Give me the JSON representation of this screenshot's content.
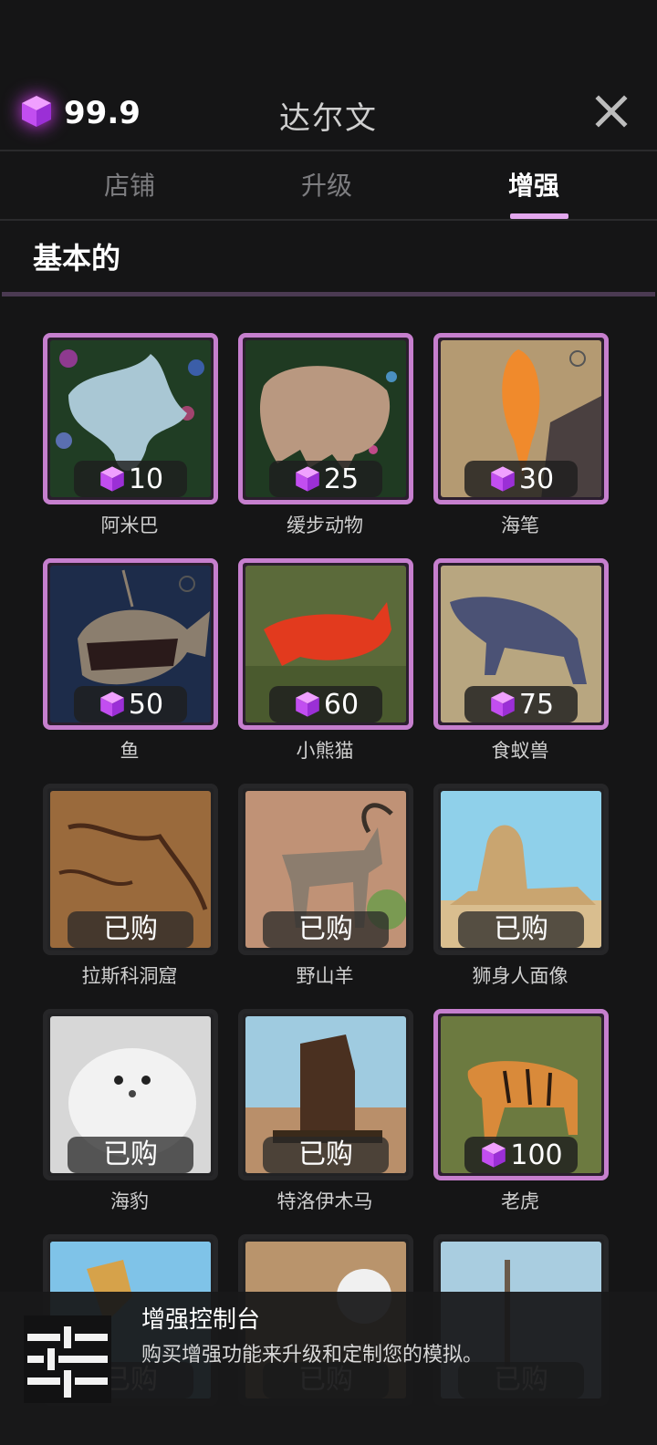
{
  "header": {
    "currency": "99.9",
    "title": "达尔文"
  },
  "tabs": [
    {
      "label": "店铺"
    },
    {
      "label": "升级"
    },
    {
      "label": "增强"
    }
  ],
  "section": {
    "title": "基本的"
  },
  "items": [
    {
      "name": "阿米巴",
      "price": "10",
      "status": "locked"
    },
    {
      "name": "缓步动物",
      "price": "25",
      "status": "locked"
    },
    {
      "name": "海笔",
      "price": "30",
      "status": "locked"
    },
    {
      "name": "鱼",
      "price": "50",
      "status": "locked"
    },
    {
      "name": "小熊猫",
      "price": "60",
      "status": "locked"
    },
    {
      "name": "食蚁兽",
      "price": "75",
      "status": "locked"
    },
    {
      "name": "拉斯科洞窟",
      "badge": "已购",
      "status": "owned"
    },
    {
      "name": "野山羊",
      "badge": "已购",
      "status": "owned"
    },
    {
      "name": "狮身人面像",
      "badge": "已购",
      "status": "owned"
    },
    {
      "name": "海豹",
      "badge": "已购",
      "status": "owned"
    },
    {
      "name": "特洛伊木马",
      "badge": "已购",
      "status": "owned"
    },
    {
      "name": "老虎",
      "price": "100",
      "status": "locked"
    },
    {
      "badge": "已购",
      "status": "owned"
    },
    {
      "badge": "已购",
      "status": "owned"
    },
    {
      "badge": "已购",
      "status": "owned"
    }
  ],
  "toast": {
    "title": "增强控制台",
    "description": "购买增强功能来升级和定制您的模拟。"
  },
  "colors": {
    "accent": "#c67fce",
    "gem": "#c64bf0",
    "background": "#151516"
  }
}
